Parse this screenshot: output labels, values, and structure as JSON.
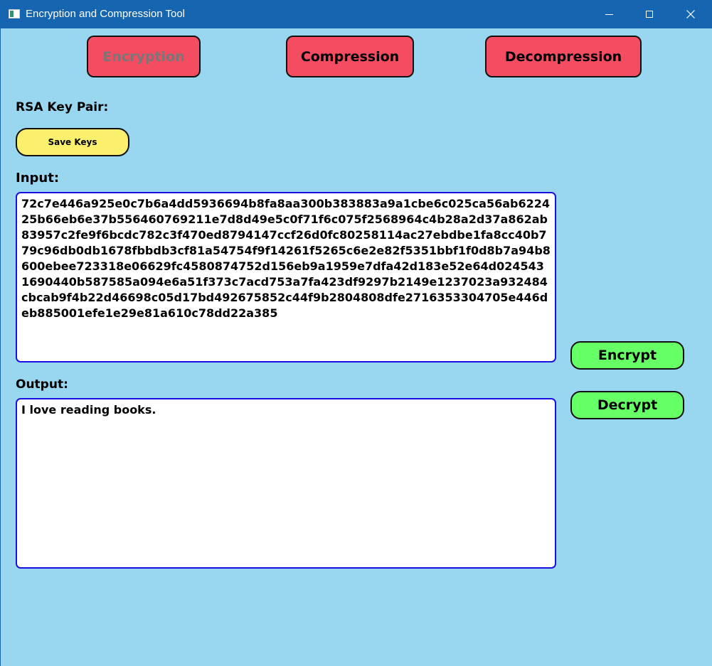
{
  "window": {
    "title": "Encryption and Compression Tool",
    "icon": "app-window-icon"
  },
  "tabs": {
    "encryption": "Encryption",
    "compression": "Compression",
    "decompression": "Decompression"
  },
  "rsa": {
    "label": "RSA Key Pair:",
    "save_label": "Save Keys"
  },
  "input": {
    "label": "Input:",
    "value": "72c7e446a925e0c7b6a4dd5936694b8fa8aa300b383883a9a1cbe6c025ca56ab622425b66eb6e37b556460769211e7d8d49e5c0f71f6c075f2568964c4b28a2d37a862ab83957c2fe9f6bcdc782c3f470ed8794147ccf26d0fc80258114ac27ebdbe1fa8cc40b779c96db0db1678fbbdb3cf81a54754f9f14261f5265c6e2e82f5351bbf1f0d8b7a94b8600ebee723318e06629fc4580874752d156eb9a1959e7dfa42d183e52e64d0245431690440b587585a094e6a51f373c7acd753a7fa423df9297b2149e1237023a932484cbcab9f4b22d46698c05d17bd492675852c44f9b2804808dfe2716353304705e446deb885001efe1e29e81a610c78dd22a385"
  },
  "output": {
    "label": "Output:",
    "value": "I love reading books."
  },
  "actions": {
    "encrypt_label": "Encrypt",
    "decrypt_label": "Decrypt"
  },
  "colors": {
    "window_bg": "#99d6f0",
    "titlebar_bg": "#1565b0",
    "tab_button_bg": "#f44d62",
    "save_button_bg": "#fbf06e",
    "action_button_bg": "#66ff66",
    "textbox_border": "#1a10e0",
    "disabled_text": "#7c7577"
  }
}
